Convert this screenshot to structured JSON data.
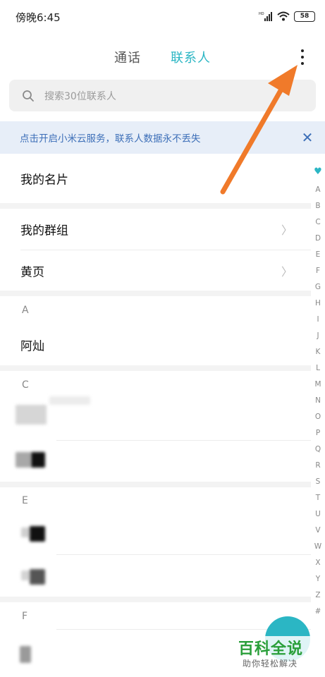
{
  "status_bar": {
    "time": "傍晚6:45",
    "battery": "58"
  },
  "tabs": {
    "calls": "通话",
    "contacts": "联系人"
  },
  "search": {
    "placeholder": "搜索30位联系人"
  },
  "banner": {
    "text": "点击开启小米云服务，联系人数据永不丢失"
  },
  "list": {
    "my_card": "我的名片",
    "my_groups": "我的群组",
    "yellow_pages": "黄页",
    "sections": [
      {
        "letter": "A",
        "contacts": [
          "阿灿"
        ]
      },
      {
        "letter": "C"
      },
      {
        "letter": "E"
      },
      {
        "letter": "F"
      }
    ]
  },
  "index_bar": [
    "A",
    "B",
    "C",
    "D",
    "E",
    "F",
    "G",
    "H",
    "I",
    "J",
    "K",
    "L",
    "M",
    "N",
    "O",
    "P",
    "Q",
    "R",
    "S",
    "T",
    "U",
    "V",
    "W",
    "X",
    "Y",
    "Z",
    "#"
  ],
  "watermark": {
    "title": "百科全说",
    "subtitle": "助你轻松解决"
  },
  "colors": {
    "accent": "#2bb6c4",
    "banner_text": "#3d6fb8",
    "annotation_arrow": "#f07a2a"
  }
}
